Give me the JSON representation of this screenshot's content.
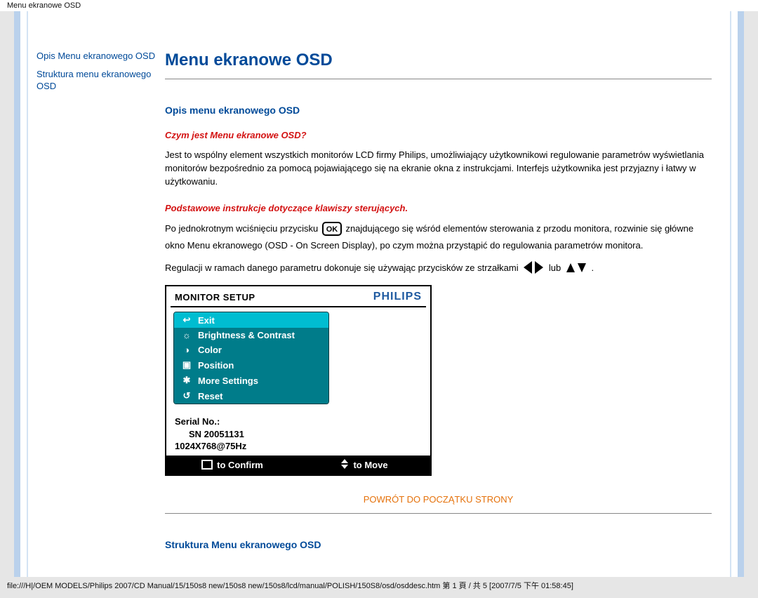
{
  "header_path_title": "Menu ekranowe OSD",
  "page_title": "Menu ekranowe OSD",
  "sidebar": {
    "items": [
      {
        "label": "Opis Menu ekranowego OSD"
      },
      {
        "label": "Struktura menu ekranowego OSD"
      }
    ]
  },
  "section1": {
    "title": "Opis menu ekranowego OSD",
    "q1": "Czym jest Menu ekranowe OSD?",
    "p1": "Jest to wspólny element wszystkich monitorów LCD firmy Philips, umożliwiający użytkownikowi regulowanie parametrów wyświetlania monitorów bezpośrednio za pomocą pojawiającego się na ekranie okna z instrukcjami. Interfejs użytkownika jest przyjazny i łatwy w użytkowaniu.",
    "q2": "Podstawowe instrukcje dotyczące klawiszy sterujących.",
    "p2a": "Po jednokrotnym wciśnięciu przycisku ",
    "p2b": " znajdującego się wśród elementów sterowania z przodu monitora, rozwinie się główne okno Menu ekranowego (OSD - On Screen Display), po czym można przystąpić do regulowania parametrów monitora.",
    "p3a": "Regulacji w ramach danego parametru dokonuje się używając przycisków ze strzałkami ",
    "p3_or": " lub ",
    "p3b": " ."
  },
  "osd": {
    "setup_label": "MONITOR SETUP",
    "brand": "PHILIPS",
    "menu": [
      {
        "icon": "↩",
        "label": "Exit"
      },
      {
        "icon": "☼",
        "label": "Brightness & Contrast"
      },
      {
        "icon": "◑",
        "label": "Color"
      },
      {
        "icon": "▣",
        "label": "Position"
      },
      {
        "icon": "✱",
        "label": "More Settings"
      },
      {
        "icon": "↺",
        "label": "Reset"
      }
    ],
    "serial_label": "Serial No.:",
    "serial_value": "SN 20051131",
    "resolution": "1024X768@75Hz",
    "confirm": "to Confirm",
    "move": "to Move"
  },
  "back_to_top": "POWRÓT DO POCZĄTKU STRONY",
  "section2": {
    "title": "Struktura Menu ekranowego OSD"
  },
  "footer_path": "file:///H|/OEM MODELS/Philips 2007/CD Manual/15/150s8 new/150s8 new/150s8/lcd/manual/POLISH/150S8/osd/osddesc.htm 第 1 頁 / 共 5  [2007/7/5 下午 01:58:45]"
}
